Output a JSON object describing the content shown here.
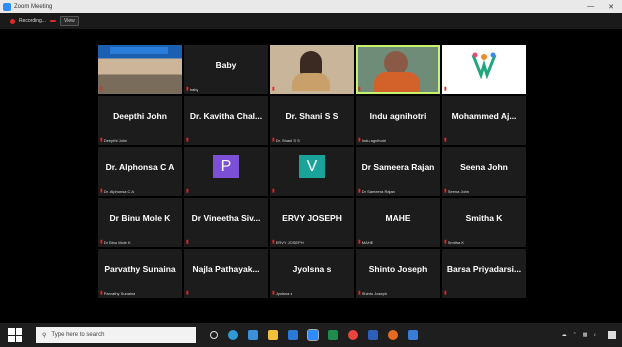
{
  "window": {
    "title": "Zoom Meeting",
    "minimize": "—",
    "close": "✕"
  },
  "recording_bar": {
    "recording_label": "Recording...",
    "status_badge": "",
    "view_label": "View"
  },
  "participants": [
    {
      "name": "",
      "tag": "",
      "video": "room"
    },
    {
      "name": "Baby",
      "tag": "baby",
      "video": "none"
    },
    {
      "name": "",
      "tag": "",
      "video": "cam1"
    },
    {
      "name": "",
      "tag": "",
      "video": "cam2",
      "active": true
    },
    {
      "name": "",
      "tag": "",
      "video": "logo"
    },
    {
      "name": "Deepthi John",
      "tag": "Deepthi John",
      "video": "none"
    },
    {
      "name": "Dr. Kavitha Chal...",
      "tag": "",
      "video": "none"
    },
    {
      "name": "Dr. Shani S S",
      "tag": "Dr. Shani S S",
      "video": "none"
    },
    {
      "name": "Indu agnihotri",
      "tag": "Indu agnihotri",
      "video": "none"
    },
    {
      "name": "Mohammed Aj...",
      "tag": "",
      "video": "none"
    },
    {
      "name": "Dr. Alphonsa C A",
      "tag": "Dr. Alphonsa C A",
      "video": "none"
    },
    {
      "name": "",
      "tag": "",
      "video": "avatar",
      "initial": "P",
      "avatar_color": "#7b4fd6"
    },
    {
      "name": "",
      "tag": "",
      "video": "avatar",
      "initial": "V",
      "avatar_color": "#1aa39a"
    },
    {
      "name": "Dr Sameera Rajan",
      "tag": "Dr Sameera Rajan",
      "video": "none"
    },
    {
      "name": "Seena John",
      "tag": "Seena John",
      "video": "none"
    },
    {
      "name": "Dr Binu Mole K",
      "tag": "Dr Binu Mole K",
      "video": "none"
    },
    {
      "name": "Dr Vineetha Siv...",
      "tag": "",
      "video": "none"
    },
    {
      "name": "ERVY JOSEPH",
      "tag": "ERVY JOSEPH",
      "video": "none"
    },
    {
      "name": "MAHE",
      "tag": "MAHE",
      "video": "none"
    },
    {
      "name": "Smitha K",
      "tag": "Smitha K",
      "video": "none"
    },
    {
      "name": "Parvathy Sunaina",
      "tag": "Parvathy Sunaina",
      "video": "none"
    },
    {
      "name": "Najla Pathayak...",
      "tag": "",
      "video": "none"
    },
    {
      "name": "Jyolsna s",
      "tag": "Jyolsna s",
      "video": "none"
    },
    {
      "name": "Shinto Joseph",
      "tag": "Shinto Joseph",
      "video": "none"
    },
    {
      "name": "Barsa Priyadarsi...",
      "tag": "",
      "video": "none"
    }
  ],
  "taskbar": {
    "search_placeholder": "Type here to search",
    "time": "",
    "date": ""
  },
  "colors": {
    "muted_mic": "#e02828",
    "active_speaker": "#c7f26e"
  }
}
